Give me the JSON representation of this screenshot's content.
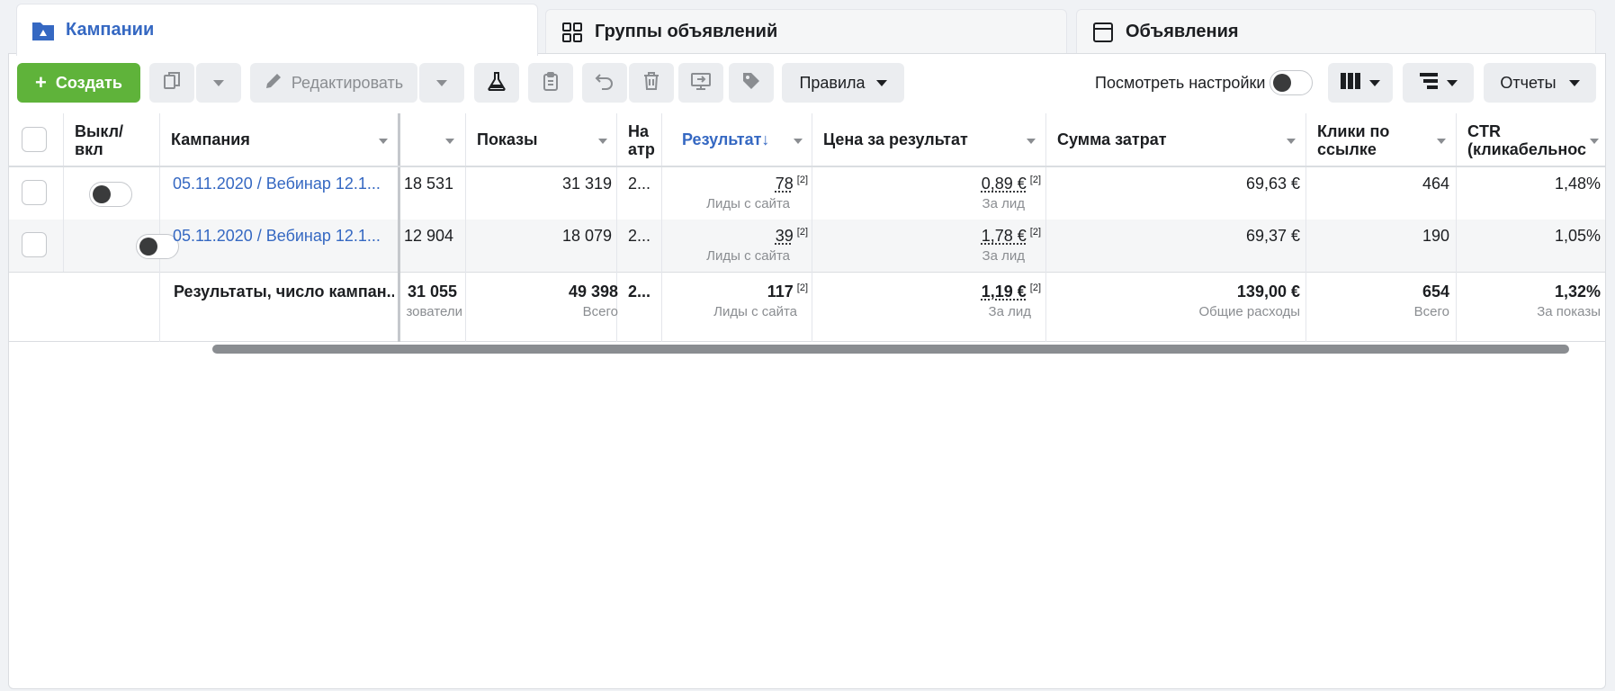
{
  "tabs": [
    {
      "label": "Кампании",
      "icon": "campaign-folder-icon"
    },
    {
      "label": "Группы объявлений",
      "icon": "grid-icon"
    },
    {
      "label": "Объявления",
      "icon": "ad-window-icon"
    }
  ],
  "toolbar": {
    "create_label": "Создать",
    "edit_label": "Редактировать",
    "rules_label": "Правила",
    "view_settings_label": "Посмотреть настройки",
    "reports_label": "Отчеты"
  },
  "table": {
    "headers": {
      "onoff": "Выкл/ вкл",
      "campaign": "Кампания",
      "impressions": "Показы",
      "partial": "На атр",
      "result": "Результат",
      "cost_per_result": "Цена за результат",
      "amount_spent": "Сумма затрат",
      "link_clicks": "Клики по ссылке",
      "ctr": "CTR (кликабельнос"
    },
    "rows": [
      {
        "campaign": "05.11.2020 / Вебинар 12.1...",
        "reach": "18 531",
        "impressions": "31 319",
        "partial": "2...",
        "result": "78",
        "result_sup": "[2]",
        "result_sub": "Лиды с сайта",
        "cpr": "0,89 €",
        "cpr_sup": "[2]",
        "cpr_sub": "За лид",
        "spent": "69,63 €",
        "clicks": "464",
        "ctr": "1,48%"
      },
      {
        "campaign": "05.11.2020 / Вебинар 12.1...",
        "reach": "12 904",
        "impressions": "18 079",
        "partial": "2...",
        "result": "39",
        "result_sup": "[2]",
        "result_sub": "Лиды с сайта",
        "cpr": "1,78 €",
        "cpr_sup": "[2]",
        "cpr_sub": "За лид",
        "spent": "69,37 €",
        "clicks": "190",
        "ctr": "1,05%"
      }
    ],
    "totals": {
      "label": "Результаты, число кампан...",
      "reach": "31 055",
      "reach_sub": "зователи",
      "impressions": "49 398",
      "impressions_sub": "Всего",
      "partial": "2...",
      "result": "117",
      "result_sup": "[2]",
      "result_sub": "Лиды с сайта",
      "cpr": "1,19 €",
      "cpr_sup": "[2]",
      "cpr_sub": "За лид",
      "spent": "139,00 €",
      "spent_sub": "Общие расходы",
      "clicks": "654",
      "clicks_sub": "Всего",
      "ctr": "1,32%",
      "ctr_sub": "За показы"
    }
  }
}
